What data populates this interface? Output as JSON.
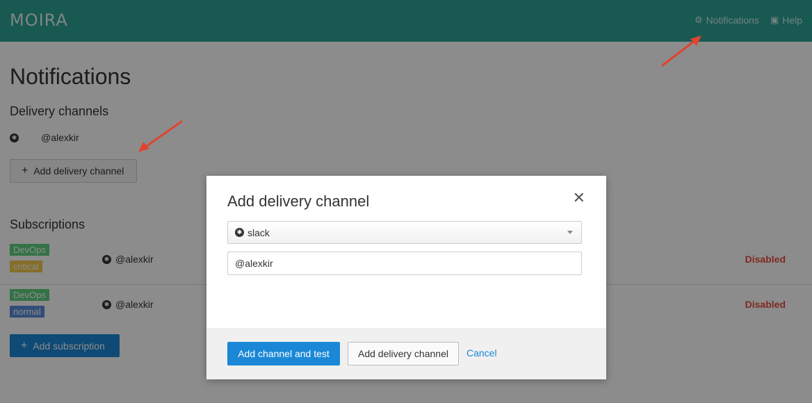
{
  "header": {
    "logo": "MOIRA",
    "nav": [
      {
        "icon": "gear-icon",
        "glyph": "⚙",
        "label": "Notifications"
      },
      {
        "icon": "book-icon",
        "glyph": "▣",
        "label": "Help"
      }
    ]
  },
  "page": {
    "title": "Notifications",
    "delivery_channels": {
      "heading": "Delivery channels",
      "channels": [
        {
          "icon": "slack-icon",
          "value": "@alexkir"
        }
      ],
      "add_button": "Add delivery channel"
    },
    "subscriptions": {
      "heading": "Subscriptions",
      "rows": [
        {
          "tags": [
            "DevOps",
            "critical"
          ],
          "contact": "@alexkir",
          "status": "Disabled"
        },
        {
          "tags": [
            "DevOps",
            "normal"
          ],
          "contact": "@alexkir",
          "status": "Disabled"
        }
      ],
      "add_button": "Add subscription"
    }
  },
  "modal": {
    "title": "Add delivery channel",
    "close_glyph": "✕",
    "select": {
      "icon": "slack-icon",
      "value": "slack"
    },
    "input_value": "@alexkir",
    "buttons": {
      "primary": "Add channel and test",
      "secondary": "Add delivery channel",
      "cancel": "Cancel"
    }
  },
  "colors": {
    "header": "#2da294",
    "primary": "#1a88d6",
    "danger": "#e74c3c",
    "arrow": "#e0442f"
  }
}
